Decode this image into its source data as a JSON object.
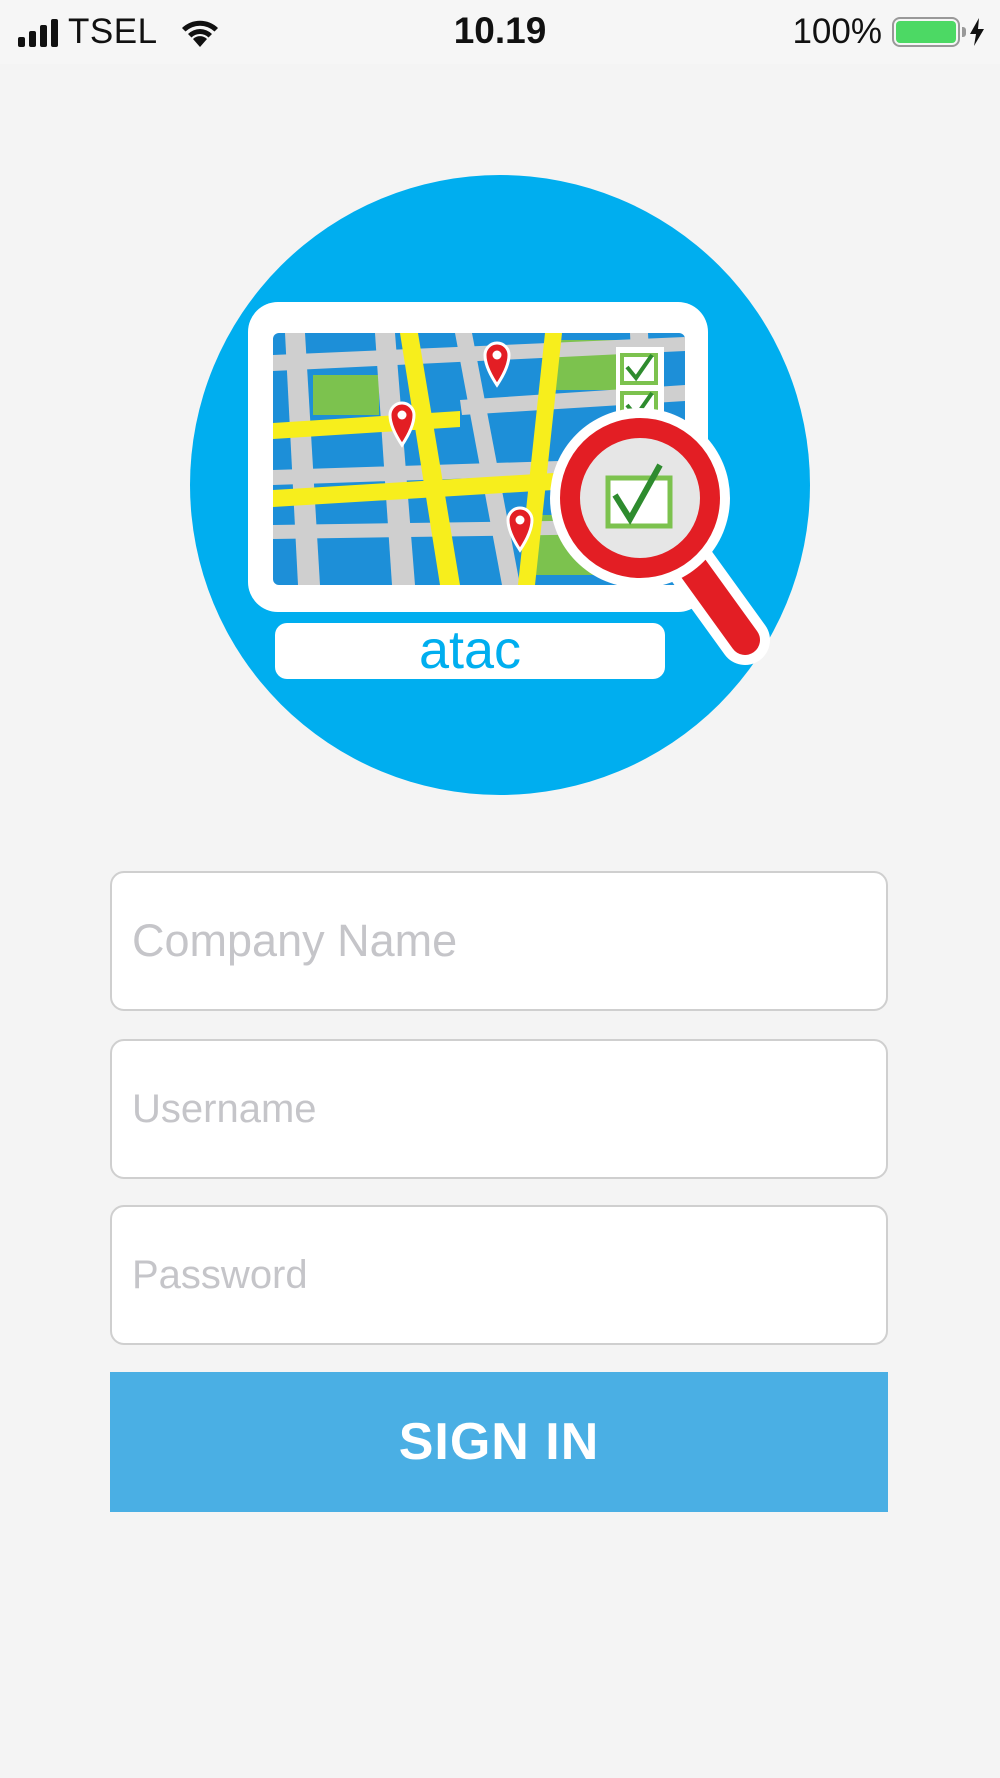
{
  "status_bar": {
    "carrier": "TSEL",
    "time": "10.19",
    "battery_percent": "100%"
  },
  "logo": {
    "brand_text": "atac",
    "circle_color": "#00aeef"
  },
  "form": {
    "company_placeholder": "Company Name",
    "username_placeholder": "Username",
    "password_placeholder": "Password",
    "company_value": "",
    "username_value": "",
    "password_value": ""
  },
  "signin_button": {
    "label": "SIGN IN",
    "color": "#4aafe4"
  }
}
